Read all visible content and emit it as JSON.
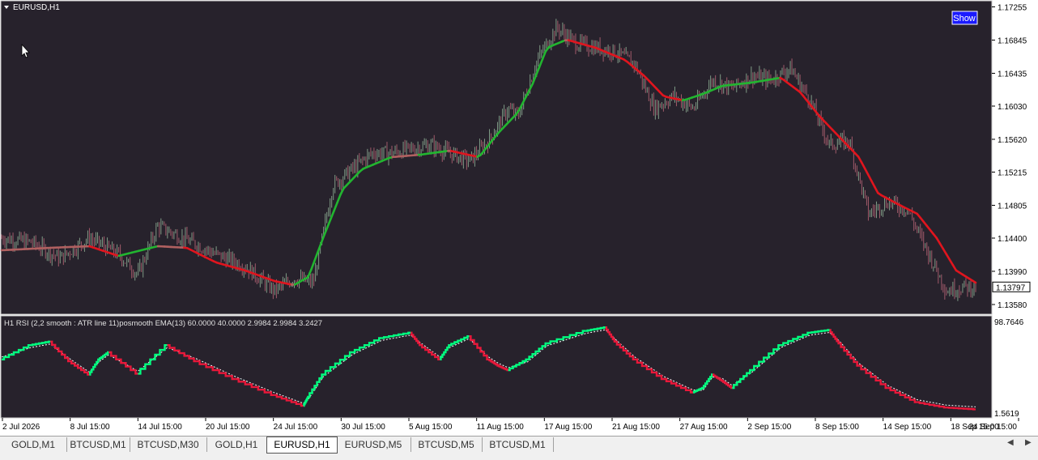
{
  "window": {
    "symbol_title": "EURUSD,H1",
    "show_button": "Show",
    "indicator_label": "H1 RSI (2,2 smooth : ATR line  11)posmooth EMA(13) 60.0000 40.0000 2.9984 2.9984 3.2427"
  },
  "tabs": [
    {
      "label": "GOLD,M1",
      "active": false
    },
    {
      "label": "BTCUSD,M1",
      "active": false
    },
    {
      "label": "BTCUSD,M30",
      "active": false
    },
    {
      "label": "GOLD,H1",
      "active": false
    },
    {
      "label": "EURUSD,H1",
      "active": true
    },
    {
      "label": "EURUSD,M5",
      "active": false
    },
    {
      "label": "BTCUSD,M5",
      "active": false
    },
    {
      "label": "BTCUSD,M1",
      "active": false
    }
  ],
  "nav": {
    "left_icon": "arrow-left-icon",
    "right_icon": "arrow-right-icon"
  },
  "colors": {
    "background": "#27222c",
    "frame": "#c8c8c8",
    "candle": "#8a9a8a",
    "ma_up": "#22b530",
    "ma_down": "#e0151e",
    "ma_flat": "#b06060",
    "rsi_up": "#00ff7f",
    "rsi_down": "#e8183a",
    "rsi_signal": "#ffffff"
  },
  "chart_data": [
    {
      "type": "candlestick",
      "symbol": "EURUSD",
      "timeframe": "H1",
      "y_ticks": [
        "1.17255",
        "1.16845",
        "1.16435",
        "1.16030",
        "1.15620",
        "1.15215",
        "1.14805",
        "1.14400",
        "1.13990",
        "1.13580"
      ],
      "ylim": [
        1.135,
        1.173
      ],
      "current_price": "1.13797",
      "x_ticks": [
        "2 Jul 2026",
        "8 Jul 15:00",
        "14 Jul 15:00",
        "20 Jul 15:00",
        "24 Jul 15:00",
        "30 Jul 15:00",
        "5 Aug 15:00",
        "11 Aug 15:00",
        "17 Aug 15:00",
        "21 Aug 15:00",
        "27 Aug 15:00",
        "2 Sep 15:00",
        "8 Sep 15:00",
        "14 Sep 15:00",
        "18 Sep 15:00",
        "24 Sep 15:00"
      ],
      "price_path": [
        [
          0,
          1.144
        ],
        [
          0.03,
          1.1435
        ],
        [
          0.06,
          1.1415
        ],
        [
          0.09,
          1.144
        ],
        [
          0.12,
          1.142
        ],
        [
          0.14,
          1.1395
        ],
        [
          0.16,
          1.1455
        ],
        [
          0.19,
          1.1438
        ],
        [
          0.22,
          1.142
        ],
        [
          0.25,
          1.1405
        ],
        [
          0.28,
          1.1375
        ],
        [
          0.3,
          1.139
        ],
        [
          0.32,
          1.1385
        ],
        [
          0.34,
          1.1505
        ],
        [
          0.36,
          1.1525
        ],
        [
          0.38,
          1.1545
        ],
        [
          0.4,
          1.1545
        ],
        [
          0.42,
          1.155
        ],
        [
          0.44,
          1.1555
        ],
        [
          0.46,
          1.1545
        ],
        [
          0.48,
          1.1535
        ],
        [
          0.5,
          1.156
        ],
        [
          0.52,
          1.16
        ],
        [
          0.53,
          1.159
        ],
        [
          0.55,
          1.166
        ],
        [
          0.57,
          1.17
        ],
        [
          0.59,
          1.168
        ],
        [
          0.61,
          1.1675
        ],
        [
          0.63,
          1.167
        ],
        [
          0.65,
          1.1655
        ],
        [
          0.67,
          1.16
        ],
        [
          0.69,
          1.1615
        ],
        [
          0.71,
          1.16
        ],
        [
          0.73,
          1.1635
        ],
        [
          0.75,
          1.1625
        ],
        [
          0.77,
          1.164
        ],
        [
          0.79,
          1.1635
        ],
        [
          0.81,
          1.165
        ],
        [
          0.83,
          1.161
        ],
        [
          0.85,
          1.1555
        ],
        [
          0.87,
          1.156
        ],
        [
          0.89,
          1.147
        ],
        [
          0.91,
          1.1485
        ],
        [
          0.93,
          1.1475
        ],
        [
          0.95,
          1.1425
        ],
        [
          0.97,
          1.1375
        ],
        [
          0.99,
          1.138
        ],
        [
          1.0,
          1.1379
        ]
      ],
      "ma_path": [
        [
          0,
          1.1425
        ],
        [
          0.05,
          1.1428
        ],
        [
          0.09,
          1.143
        ],
        [
          0.12,
          1.1418
        ],
        [
          0.16,
          1.143
        ],
        [
          0.19,
          1.1428
        ],
        [
          0.22,
          1.141
        ],
        [
          0.25,
          1.14
        ],
        [
          0.28,
          1.1387
        ],
        [
          0.3,
          1.1382
        ],
        [
          0.315,
          1.1392
        ],
        [
          0.33,
          1.144
        ],
        [
          0.35,
          1.15
        ],
        [
          0.37,
          1.1525
        ],
        [
          0.4,
          1.154
        ],
        [
          0.43,
          1.1543
        ],
        [
          0.46,
          1.1548
        ],
        [
          0.49,
          1.154
        ],
        [
          0.51,
          1.157
        ],
        [
          0.53,
          1.1595
        ],
        [
          0.545,
          1.163
        ],
        [
          0.56,
          1.1675
        ],
        [
          0.58,
          1.1685
        ],
        [
          0.61,
          1.1675
        ],
        [
          0.64,
          1.166
        ],
        [
          0.66,
          1.164
        ],
        [
          0.68,
          1.1615
        ],
        [
          0.7,
          1.161
        ],
        [
          0.72,
          1.1618
        ],
        [
          0.74,
          1.1628
        ],
        [
          0.77,
          1.1632
        ],
        [
          0.8,
          1.1638
        ],
        [
          0.82,
          1.162
        ],
        [
          0.84,
          1.159
        ],
        [
          0.86,
          1.1565
        ],
        [
          0.88,
          1.154
        ],
        [
          0.9,
          1.1495
        ],
        [
          0.92,
          1.1482
        ],
        [
          0.94,
          1.147
        ],
        [
          0.96,
          1.144
        ],
        [
          0.98,
          1.14
        ],
        [
          1.0,
          1.1385
        ]
      ]
    },
    {
      "type": "line",
      "title": "H1 RSI (2,2 smooth : ATR line  11)posmooth EMA(13) 60.0000 40.0000 2.9984 2.9984 3.2427",
      "y_ticks": [
        "98.7646",
        "1.5619"
      ],
      "ylim": [
        1.5619,
        98.7646
      ],
      "rsi_path": [
        [
          0,
          0.62,
          "d"
        ],
        [
          0.03,
          0.78,
          "u"
        ],
        [
          0.05,
          0.82,
          "u"
        ],
        [
          0.07,
          0.6,
          "d"
        ],
        [
          0.09,
          0.45,
          "d"
        ],
        [
          0.1,
          0.62,
          "u"
        ],
        [
          0.11,
          0.7,
          "u"
        ],
        [
          0.14,
          0.46,
          "d"
        ],
        [
          0.17,
          0.78,
          "u"
        ],
        [
          0.2,
          0.6,
          "d"
        ],
        [
          0.24,
          0.4,
          "d"
        ],
        [
          0.28,
          0.22,
          "d"
        ],
        [
          0.31,
          0.1,
          "d"
        ],
        [
          0.315,
          0.2,
          "u"
        ],
        [
          0.33,
          0.45,
          "u"
        ],
        [
          0.36,
          0.7,
          "u"
        ],
        [
          0.39,
          0.86,
          "u"
        ],
        [
          0.42,
          0.92,
          "u"
        ],
        [
          0.43,
          0.78,
          "d"
        ],
        [
          0.45,
          0.62,
          "d"
        ],
        [
          0.46,
          0.78,
          "u"
        ],
        [
          0.48,
          0.88,
          "u"
        ],
        [
          0.5,
          0.62,
          "d"
        ],
        [
          0.51,
          0.55,
          "d"
        ],
        [
          0.52,
          0.5,
          "d"
        ],
        [
          0.54,
          0.62,
          "u"
        ],
        [
          0.56,
          0.8,
          "u"
        ],
        [
          0.6,
          0.94,
          "u"
        ],
        [
          0.62,
          0.98,
          "u"
        ],
        [
          0.63,
          0.82,
          "d"
        ],
        [
          0.65,
          0.62,
          "d"
        ],
        [
          0.68,
          0.4,
          "d"
        ],
        [
          0.71,
          0.25,
          "d"
        ],
        [
          0.72,
          0.3,
          "u"
        ],
        [
          0.73,
          0.45,
          "u"
        ],
        [
          0.74,
          0.38,
          "d"
        ],
        [
          0.75,
          0.3,
          "d"
        ],
        [
          0.77,
          0.5,
          "u"
        ],
        [
          0.8,
          0.78,
          "u"
        ],
        [
          0.83,
          0.92,
          "u"
        ],
        [
          0.85,
          0.95,
          "u"
        ],
        [
          0.86,
          0.8,
          "d"
        ],
        [
          0.88,
          0.55,
          "d"
        ],
        [
          0.91,
          0.3,
          "d"
        ],
        [
          0.94,
          0.14,
          "d"
        ],
        [
          0.97,
          0.08,
          "d"
        ],
        [
          1.0,
          0.06,
          "d"
        ]
      ]
    }
  ]
}
